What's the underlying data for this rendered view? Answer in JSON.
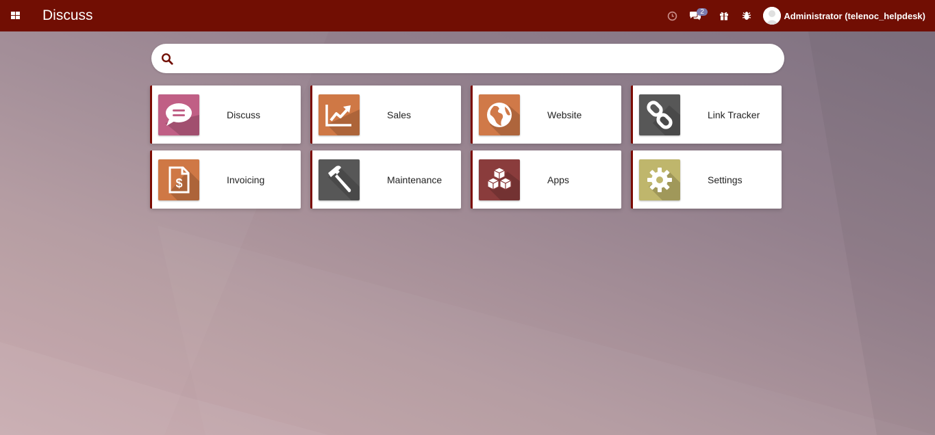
{
  "topbar": {
    "brand": "Discuss",
    "messages_count": "2",
    "user_name": "Administrator (telenoc_helpdesk)"
  },
  "search": {
    "placeholder": "",
    "value": ""
  },
  "apps": [
    {
      "label": "Discuss",
      "icon": "chat-bubble-icon",
      "color": "#c05f85"
    },
    {
      "label": "Sales",
      "icon": "trending-chart-icon",
      "color": "#cf7845"
    },
    {
      "label": "Website",
      "icon": "globe-icon",
      "color": "#d07948"
    },
    {
      "label": "Link Tracker",
      "icon": "chain-link-icon",
      "color": "#575757"
    },
    {
      "label": "Invoicing",
      "icon": "invoice-dollar-icon",
      "color": "#cf7845"
    },
    {
      "label": "Maintenance",
      "icon": "hammer-icon",
      "color": "#575757"
    },
    {
      "label": "Apps",
      "icon": "cubes-icon",
      "color": "#8a3c3c"
    },
    {
      "label": "Settings",
      "icon": "gear-icon",
      "color": "#bfb66c"
    }
  ],
  "colors": {
    "topbar": "#710e03",
    "accent": "#7c0a02",
    "badge": "#7c7bad"
  }
}
